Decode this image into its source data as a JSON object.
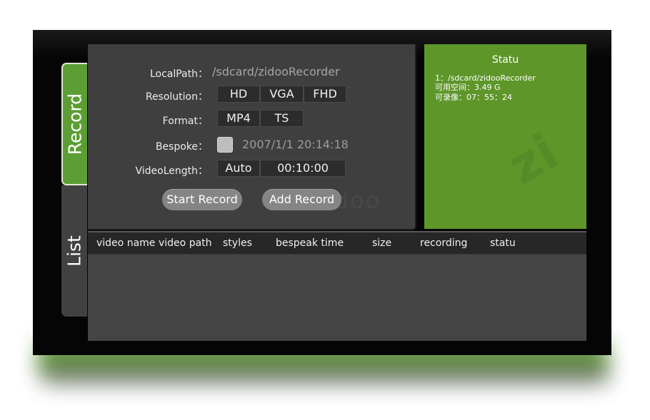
{
  "tabs": {
    "record_label": "Record",
    "list_label": "List"
  },
  "form": {
    "local_path_label": "LocalPath：",
    "local_path_value": "/sdcard/zidooRecorder",
    "resolution_label": "Resolution：",
    "resolution_options": [
      "HD",
      "VGA",
      "FHD"
    ],
    "format_label": "Format：",
    "format_options": [
      "MP4",
      "TS"
    ],
    "bespoke_label": "Bespoke：",
    "bespoke_datetime": "2007/1/1 20:14:18",
    "video_length_label": "VideoLength：",
    "video_length_mode": "Auto",
    "video_length_value": "00:10:00",
    "start_record_label": "Start Record",
    "add_record_label": "Add Record"
  },
  "status_panel": {
    "title": "Statu",
    "lines": [
      "1：/sdcard/zidooRecorder",
      "可用空间：3.49 G",
      "可录像：07：55：24"
    ]
  },
  "table": {
    "columns": [
      "video name",
      "video path",
      "styles",
      "bespeak time",
      "size",
      "recording",
      "statu"
    ],
    "rows": []
  },
  "colors": {
    "accent_green": "#5e962a",
    "panel_gray": "#3f3f3f",
    "header_dark": "#272727"
  }
}
